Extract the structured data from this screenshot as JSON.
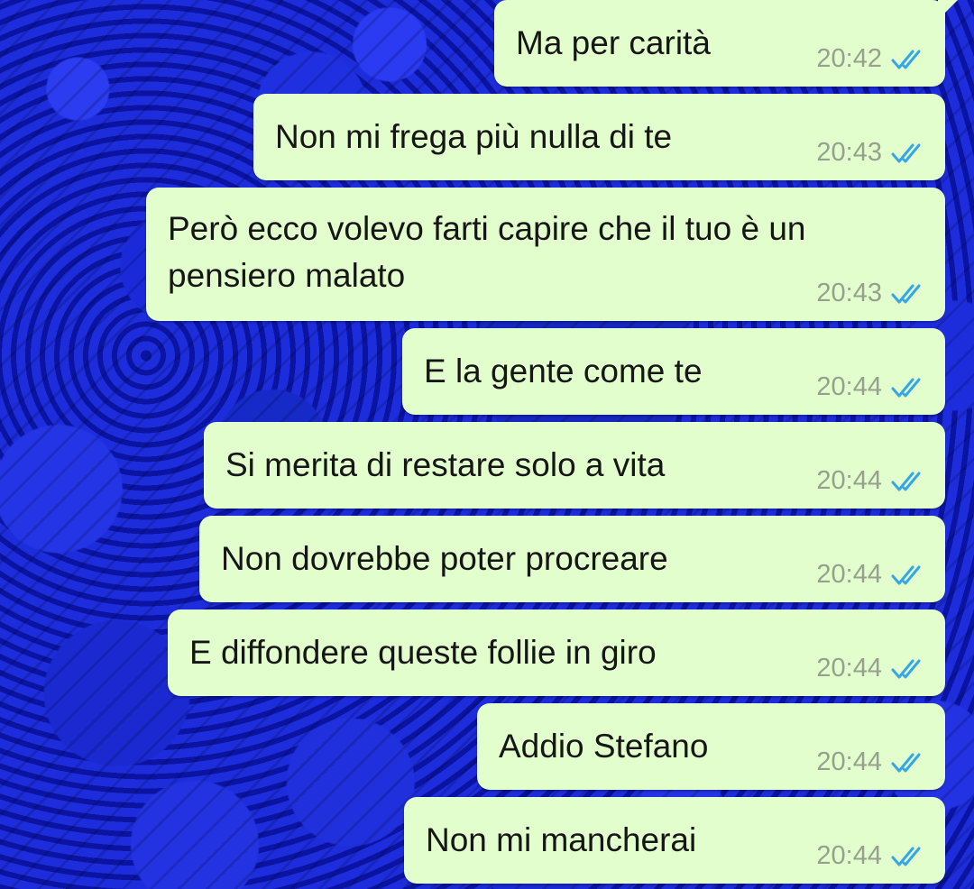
{
  "messages": [
    {
      "text": "Ma per carità",
      "time": "20:42"
    },
    {
      "text": "Non mi frega più nulla di te",
      "time": "20:43"
    },
    {
      "text": "Però ecco volevo farti capire che il tuo è un\npensiero malato",
      "time": "20:43"
    },
    {
      "text": "E la gente come te",
      "time": "20:44"
    },
    {
      "text": "Si merita di restare solo a vita",
      "time": "20:44"
    },
    {
      "text": "Non dovrebbe poter procreare",
      "time": "20:44"
    },
    {
      "text": "E diffondere queste follie in giro",
      "time": "20:44"
    },
    {
      "text": "Addio Stefano",
      "time": "20:44"
    },
    {
      "text": "Non mi mancherai",
      "time": "20:44"
    }
  ],
  "colors": {
    "bubble": "#e2fecd",
    "read_tick": "#35a7e8",
    "time": "#97a08f"
  },
  "icons": {
    "status": "double-check-icon"
  }
}
